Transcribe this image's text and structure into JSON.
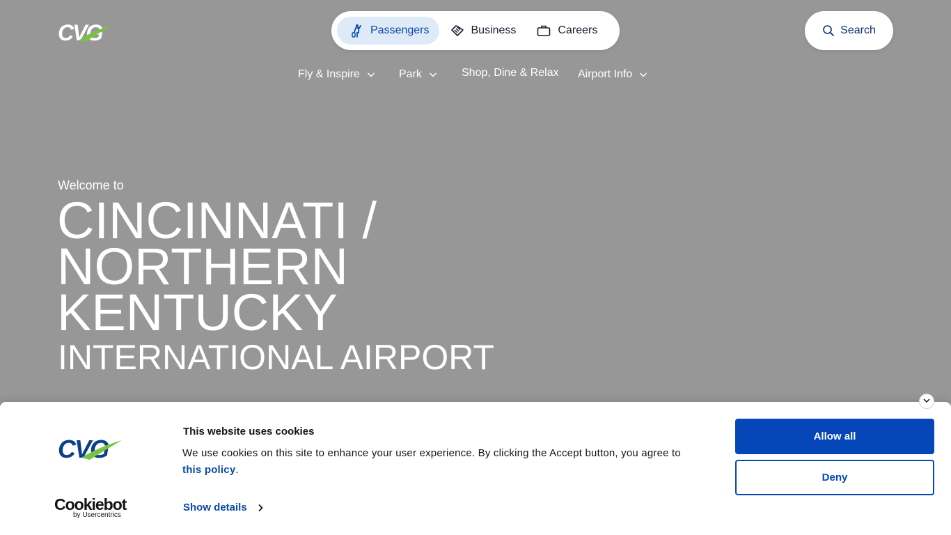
{
  "header": {
    "logo_text": "CVG",
    "audience": [
      {
        "label": "Passengers",
        "icon": "passenger-icon",
        "active": true
      },
      {
        "label": "Business",
        "icon": "handshake-icon",
        "active": false
      },
      {
        "label": "Careers",
        "icon": "briefcase-icon",
        "active": false
      }
    ],
    "search_label": "Search"
  },
  "nav": [
    {
      "label": "Fly & Inspire",
      "has_dropdown": true
    },
    {
      "label": "Park",
      "has_dropdown": true
    },
    {
      "label": "Shop, Dine & Relax",
      "has_dropdown": false
    },
    {
      "label": "Airport Info",
      "has_dropdown": true
    }
  ],
  "hero": {
    "welcome": "Welcome to",
    "title_lines": [
      "CINCINNATI /",
      "NORTHERN",
      "KENTUCKY"
    ],
    "subtitle": "INTERNATIONAL AIRPORT"
  },
  "cookie": {
    "logo_text": "CVG",
    "provider_name": "Cookiebot",
    "provider_by": "by Usercentrics",
    "title": "This website uses cookies",
    "text_before": "We use cookies on this site to enhance your user experience. By clicking the Accept button, you agree to ",
    "link_text": "this policy",
    "text_after": ".",
    "show_details": "Show details",
    "allow_label": "Allow all",
    "deny_label": "Deny"
  },
  "colors": {
    "background": "#979797",
    "brand_blue": "#0546b8",
    "brand_green": "#7cc242",
    "active_pill": "#dfeaf8"
  }
}
